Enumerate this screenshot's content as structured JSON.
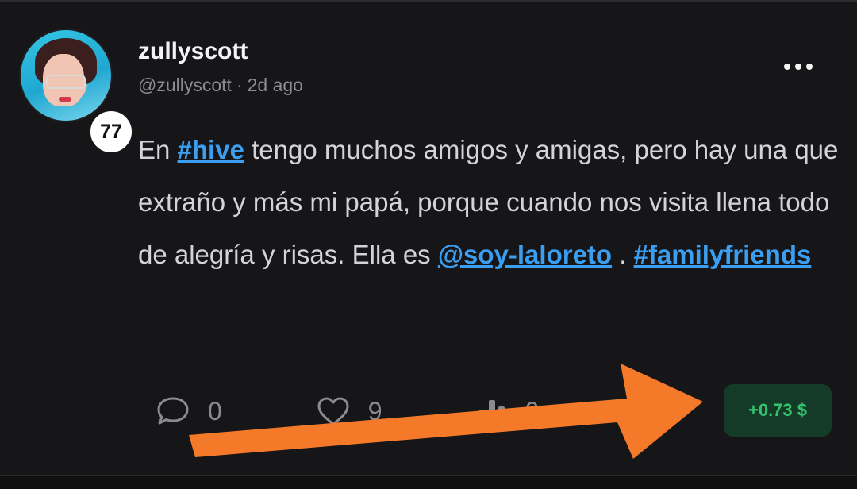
{
  "author": {
    "display_name": "zullyscott",
    "handle": "@zullyscott",
    "separator": "·",
    "time_ago": "2d ago",
    "reputation": "77"
  },
  "post": {
    "text_1": "En ",
    "tag_1": "#hive",
    "text_2": " tengo muchos amigos y amigas, pero hay una que extraño y más mi papá, porque cuando nos visita llena todo de alegría y risas. Ella es ",
    "mention": "@soy-laloreto",
    "text_3": " . ",
    "tag_2": "#familyfriends"
  },
  "actions": {
    "comments_count": "0",
    "likes_count": "9",
    "votes_count": "0"
  },
  "payout": {
    "label": "+0.73 $"
  },
  "colors": {
    "background": "#161618",
    "link": "#3b9ef0",
    "payout_text": "#34c46c",
    "payout_bg": "#143a28",
    "arrow": "#f47a2a"
  },
  "icons": {
    "menu": "more-horizontal-icon",
    "comment": "comment-icon",
    "like": "heart-icon",
    "stats": "bar-chart-icon"
  }
}
